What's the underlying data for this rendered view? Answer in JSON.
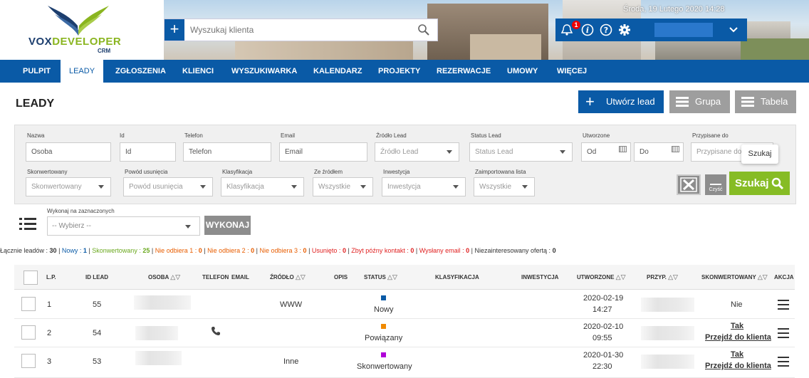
{
  "app": {
    "logo_main": "VOX",
    "logo_highlight": "DEVELOPER",
    "logo_sub": "CRM"
  },
  "header": {
    "search_placeholder": "Wyszukaj klienta",
    "notification_count": "1",
    "date": "Środa, 19 Lutego 2020  14:28"
  },
  "nav": [
    "PULPIT",
    "LEADY",
    "ZGŁOSZENIA",
    "KLIENCI",
    "WYSZUKIWARKA",
    "KALENDARZ",
    "PROJEKTY",
    "REZERWACJE",
    "UMOWY",
    "WIĘCEJ"
  ],
  "page": {
    "title": "LEADY",
    "create_label": "Utwórz lead",
    "grupa_label": "Grupa",
    "tabela_label": "Tabela"
  },
  "filters": {
    "nazwa": {
      "label": "Nazwa",
      "value": "Osoba"
    },
    "id": {
      "label": "Id",
      "value": "Id"
    },
    "telefon": {
      "label": "Telefon",
      "value": "Telefon"
    },
    "email": {
      "label": "Email",
      "value": "Email"
    },
    "zrodlo": {
      "label": "Źródło Lead",
      "value": "Źródło Lead"
    },
    "status": {
      "label": "Status Lead",
      "value": "Status Lead"
    },
    "utworzone": {
      "label": "Utworzone",
      "od": "Od",
      "do": "Do"
    },
    "przypisane": {
      "label": "Przypisane do",
      "value": "Przypisane do"
    },
    "skonwertowany": {
      "label": "Skonwertowany",
      "value": "Skonwertowany"
    },
    "powod": {
      "label": "Powód usunięcia",
      "value": "Powód usunięcia"
    },
    "klasyfikacja": {
      "label": "Klasyfikacja",
      "value": "Klasyfikacja"
    },
    "ze_zrodlem": {
      "label": "Ze źródłem",
      "value": "Wszystkie"
    },
    "inwestycja": {
      "label": "Inwestycja",
      "value": "Inwestycja"
    },
    "zaimportowana": {
      "label": "Zaimportowana lista",
      "value": "Wszystkie"
    },
    "tooltip": "Szukaj",
    "clear_label": "Czyść",
    "search_label": "Szukaj"
  },
  "bulk": {
    "label": "Wykonaj na zaznaczonych",
    "placeholder": "-- Wybierz --",
    "button": "WYKONAJ"
  },
  "summary": [
    {
      "text": "Łącznie leadów : ",
      "value": "30",
      "color": "#333333"
    },
    {
      "text": "Nowy : ",
      "value": "1",
      "color": "#0a5aa6"
    },
    {
      "text": "Skonwertowany : ",
      "value": "25",
      "color": "#6aa81e"
    },
    {
      "text": "Nie odbiera 1 : ",
      "value": "0",
      "color": "#e85d00"
    },
    {
      "text": "Nie odbiera 2 : ",
      "value": "0",
      "color": "#e85d00"
    },
    {
      "text": "Nie odbiera 3 : ",
      "value": "0",
      "color": "#e85d00"
    },
    {
      "text": "Usunięto : ",
      "value": "0",
      "color": "#e02020"
    },
    {
      "text": "Zbyt późny kontakt : ",
      "value": "0",
      "color": "#e02020"
    },
    {
      "text": "Wysłany email : ",
      "value": "0",
      "color": "#e02020"
    },
    {
      "text": "Niezainteresowany ofertą : ",
      "value": "0",
      "color": "#333333"
    }
  ],
  "table": {
    "headers": {
      "lp": "L.P.",
      "id": "ID LEAD",
      "osoba": "OSOBA",
      "telefon": "TELEFON",
      "email": "EMAIL",
      "zrodlo": "ŹRÓDŁO",
      "opis": "OPIS",
      "status": "STATUS",
      "klasyfikacja": "KLASYFIKACJA",
      "inwestycja": "INWESTYCJA",
      "utworzone": "UTWORZONE",
      "przyp": "PRZYP.",
      "skonwertowany": "SKONWERTOWANY",
      "akcja": "AKCJA"
    },
    "sort_icon": "△▽",
    "rows": [
      {
        "lp": "1",
        "id": "55",
        "zrodlo": "WWW",
        "status": "Nowy",
        "status_color": "#0a5aa6",
        "date": "2020-02-19",
        "time": "14:27",
        "konw": "Nie",
        "link": ""
      },
      {
        "lp": "2",
        "id": "54",
        "zrodlo": "",
        "status": "Powiązany",
        "status_color": "#f08a00",
        "date": "2020-02-10",
        "time": "09:55",
        "konw": "Tak",
        "link": "Przejdź do klienta"
      },
      {
        "lp": "3",
        "id": "53",
        "zrodlo": "Inne",
        "status": "Skonwertowany",
        "status_color": "#b000d8",
        "date": "2020-01-30",
        "time": "22:30",
        "konw": "Tak",
        "link": "Przejdź do klienta"
      }
    ]
  }
}
